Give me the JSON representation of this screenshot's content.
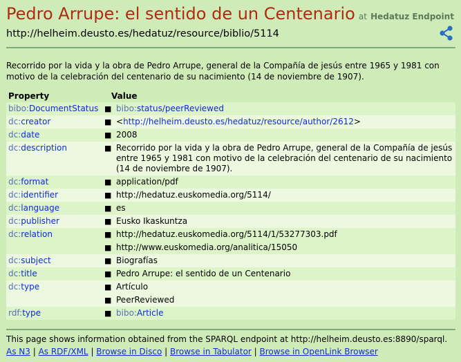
{
  "header": {
    "title": "Pedro Arrupe: el sentido de un Centenario",
    "at": "at",
    "endpoint": "Hedatuz Endpoint",
    "uri": "http://helheim.deusto.es/hedatuz/resource/biblio/5114",
    "share_icon": "share-icon"
  },
  "description": "Recorrido por la vida y la obra de Pedro Arrupe, general de la Compañía de jesús entre 1965 y 1981 con motivo de la celebración del centenario de su nacimiento (14 de noviembre de 1907).",
  "table": {
    "col_property": "Property",
    "col_value": "Value",
    "rows": [
      {
        "ns": "bibo:",
        "local": "DocumentStatus",
        "values": [
          {
            "ns": "bibo:",
            "text": "status/peerReviewed",
            "link": true
          }
        ]
      },
      {
        "ns": "dc:",
        "local": "creator",
        "values": [
          {
            "pre": "<",
            "text": "http://helheim.deusto.es/hedatuz/resource/author/2612",
            "post": ">",
            "link": true
          }
        ]
      },
      {
        "ns": "dc:",
        "local": "date",
        "values": [
          {
            "text": "2008"
          }
        ]
      },
      {
        "ns": "dc:",
        "local": "description",
        "values": [
          {
            "text": "Recorrido por la vida y la obra de Pedro Arrupe, general de la Compañía de jesús entre 1965 y 1981 con motivo de la celebración del centenario de su nacimiento (14 de noviembre de 1907)."
          }
        ]
      },
      {
        "ns": "dc:",
        "local": "format",
        "values": [
          {
            "text": "application/pdf"
          }
        ]
      },
      {
        "ns": "dc:",
        "local": "identifier",
        "values": [
          {
            "text": "http://hedatuz.euskomedia.org/5114/"
          }
        ]
      },
      {
        "ns": "dc:",
        "local": "language",
        "values": [
          {
            "text": "es"
          }
        ]
      },
      {
        "ns": "dc:",
        "local": "publisher",
        "values": [
          {
            "text": "Eusko Ikaskuntza"
          }
        ]
      },
      {
        "ns": "dc:",
        "local": "relation",
        "values": [
          {
            "text": "http://hedatuz.euskomedia.org/5114/1/53277303.pdf"
          },
          {
            "text": "http://www.euskomedia.org/analitica/15050"
          }
        ]
      },
      {
        "ns": "dc:",
        "local": "subject",
        "values": [
          {
            "text": "Biografías"
          }
        ]
      },
      {
        "ns": "dc:",
        "local": "title",
        "values": [
          {
            "text": "Pedro Arrupe: el sentido de un Centenario"
          }
        ]
      },
      {
        "ns": "dc:",
        "local": "type",
        "values": [
          {
            "text": "Artículo"
          },
          {
            "text": "PeerReviewed"
          }
        ]
      },
      {
        "ns": "rdf:",
        "local": "type",
        "values": [
          {
            "ns": "bibo:",
            "text": "Article",
            "link": true
          }
        ]
      }
    ]
  },
  "footer": {
    "text": "This page shows information obtained from the SPARQL endpoint at http://helheim.deusto.es:8890/sparql.",
    "links": [
      "As N3",
      "As RDF/XML",
      "Browse in Disco",
      "Browse in Tabulator",
      "Browse in OpenLink Browser"
    ],
    "separator": " | "
  },
  "colors": {
    "background": "#cfecb8",
    "title": "#b02a14",
    "link": "#0f2bd6",
    "namespace": "#5570b8",
    "row_odd": "#ddf3c8",
    "row_even": "#ecf9e0"
  }
}
